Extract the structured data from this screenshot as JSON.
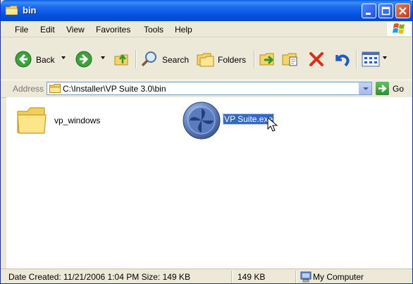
{
  "window": {
    "title": "bin"
  },
  "menu": [
    "File",
    "Edit",
    "View",
    "Favorites",
    "Tools",
    "Help"
  ],
  "toolbar": {
    "back": "Back",
    "search": "Search",
    "folders": "Folders"
  },
  "address": {
    "label": "Address",
    "path": "C:\\Installer\\VP Suite 3.0\\bin",
    "go": "Go"
  },
  "files": [
    {
      "name": "vp_windows",
      "type": "folder"
    },
    {
      "name": "VP Suite.exe",
      "type": "application",
      "selected": true
    }
  ],
  "status": {
    "info": "Date Created: 11/21/2006 1:04 PM Size: 149 KB",
    "size": "149 KB",
    "zone": "My Computer"
  },
  "colors": {
    "titlebar": "#0553e0",
    "selection": "#316ac5",
    "chrome": "#ece9d8"
  }
}
